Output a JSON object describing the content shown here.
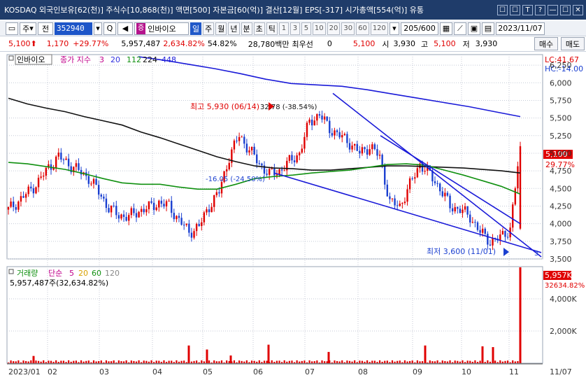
{
  "window": {
    "title": "KOSDAQ 외국인보유[62(천)] 주식수[10,868(천)] 액면[500] 자본금[60(억)] 결산[12월] EPS[-317] 시가총액[554(억)] 유통",
    "controls": [
      "☐",
      "☐",
      "T",
      "?",
      "—",
      "☐",
      "✕"
    ]
  },
  "toolbar": {
    "first_label": "주",
    "prev_label": "전",
    "code": "352940",
    "zoom_label": "Q",
    "speaker_label": "◀",
    "jeung": "증",
    "name": "인바이오",
    "periods": [
      "일",
      "주",
      "월",
      "년",
      "분",
      "초",
      "틱"
    ],
    "active_period": "일",
    "numbers": [
      "1",
      "3",
      "5",
      "10",
      "20",
      "30",
      "60",
      "120"
    ],
    "count": "205",
    "count_total": "/600",
    "date": "2023/11/07"
  },
  "quote": {
    "price": "5,100",
    "arrow": "⬆",
    "change": "1,170",
    "change_pct": "+29.77%",
    "volume": "5,957,487",
    "volume_pct": "2,634.82%",
    "turnover": "54.82%",
    "amount": "28,780백만",
    "pref_label": "최우선",
    "pref_value": "0",
    "pref_price": "5,100",
    "open_label": "시",
    "open": "3,930",
    "high_label": "고",
    "high": "5,100",
    "low_label": "저",
    "low": "3,930",
    "buy": "매수",
    "sell": "매도"
  },
  "chart_data": {
    "type": "candlestick",
    "legend": {
      "name": "인바이오",
      "ma_label": "종가 지수",
      "ma_periods": [
        "3",
        "20",
        "112",
        "224",
        "448"
      ],
      "colors": {
        "3": "#c0008a",
        "20": "#3030e0",
        "112": "#109010",
        "224": "#111111",
        "448": "#1a1ad8"
      }
    },
    "yaxis": {
      "ticks": [
        "6,250",
        "6,000",
        "5,750",
        "5,500",
        "5,250",
        "5,000",
        "4,750",
        "4,500",
        "4,250",
        "4,000",
        "3,750",
        "3,500"
      ],
      "tick_values": [
        6250,
        6000,
        5750,
        5500,
        5250,
        5000,
        4750,
        4500,
        4250,
        4000,
        3750,
        3500
      ],
      "range": [
        3500,
        6400
      ],
      "lc": "LC:41.67",
      "hc": "HC:-14.00",
      "last_price": "5,100",
      "last_pct": "29.77%"
    },
    "xaxis": {
      "labels": [
        "2023/01",
        "02",
        "03",
        "04",
        "05",
        "06",
        "07",
        "08",
        "09",
        "10",
        "11",
        "11/07"
      ]
    },
    "annotations": {
      "high": "최고 5,930 (06/14)",
      "high_pct": "32.78 (-38.54%)",
      "mid": "-16.05 (-24.50%)",
      "low": "최저 3,600 (11/01)",
      "wave": "3"
    },
    "ma224_series": [
      5780,
      5700,
      5640,
      5590,
      5520,
      5460,
      5400,
      5300,
      5220,
      5130,
      5040,
      4950,
      4880,
      4820,
      4790,
      4780,
      4760,
      4760,
      4780,
      4800,
      4820,
      4820,
      4810,
      4800,
      4790,
      4770,
      4750,
      4720
    ],
    "ma112_series": [
      4870,
      4850,
      4810,
      4770,
      4710,
      4640,
      4580,
      4560,
      4560,
      4520,
      4490,
      4490,
      4560,
      4640,
      4670,
      4690,
      4720,
      4740,
      4760,
      4800,
      4840,
      4850,
      4830,
      4760,
      4690,
      4610,
      4530,
      4420
    ],
    "ma448_series": [
      6370,
      6320,
      6260,
      6200,
      6130,
      6050,
      5990,
      5970,
      5950,
      5900,
      5840,
      5780,
      5720,
      5660,
      5590,
      5520
    ],
    "trend_lines": [
      {
        "name": "upper-channel",
        "from": [
          5720,
          5850
        ],
        "to": [
          5770,
          3530
        ]
      },
      {
        "name": "lower-channel",
        "from": [
          5390,
          4720
        ],
        "to": [
          5770,
          3590
        ]
      },
      {
        "name": "support-line",
        "from": [
          5490,
          5250
        ],
        "to": [
          5680,
          4000
        ]
      }
    ],
    "price_samples": [
      4200,
      4320,
      4450,
      4600,
      4800,
      4950,
      4850,
      4750,
      4650,
      4450,
      4220,
      4120,
      4100,
      4180,
      4230,
      4300,
      4250,
      4050,
      3880,
      3960,
      4250,
      4450,
      4950,
      5250,
      5050,
      4850,
      4700,
      4750,
      4880,
      5000,
      5450,
      5550,
      5350,
      5250,
      5150,
      5000,
      5100,
      4950,
      4300,
      4250,
      4550,
      4850,
      4700,
      4500,
      4250,
      4200,
      4100,
      3880,
      3750,
      3800,
      3930,
      5100
    ],
    "volume": {
      "label": "거래량",
      "ma_label": "단순",
      "ma_periods": [
        "5",
        "20",
        "60",
        "120"
      ],
      "colors": {
        "5": "#c0008a",
        "20": "#d8a000",
        "60": "#109010",
        "120": "#888888"
      },
      "info": "5,957,487주(32,634.82%)",
      "ticks": [
        "4,000K",
        "2,000K"
      ],
      "tick_values": [
        4000,
        2000
      ],
      "range_k": [
        0,
        6000
      ],
      "last": "5,957K",
      "last_pct": "32634.82%",
      "last_value_k": 5957,
      "spikes_k": [
        450,
        1100,
        850,
        480,
        1150,
        700,
        1100,
        1050,
        1000,
        5957
      ]
    }
  }
}
